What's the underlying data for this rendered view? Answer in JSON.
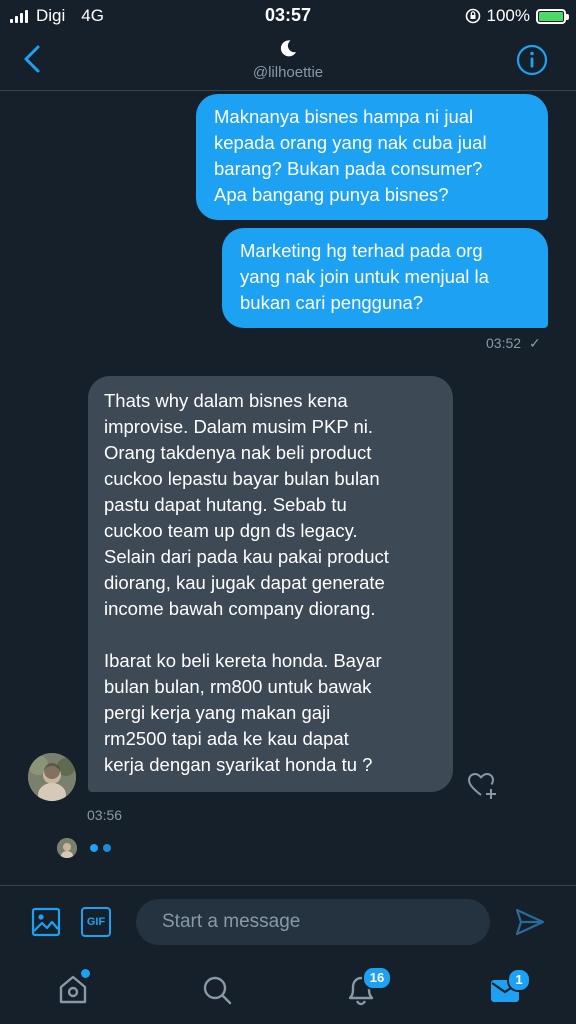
{
  "status_bar": {
    "carrier": "Digi",
    "network": "4G",
    "time": "03:57",
    "battery": "100%"
  },
  "header": {
    "handle": "@lilhoettie"
  },
  "conversation": {
    "sent_1": [
      "Maknanya bisnes hampa ni jual",
      "kepada orang yang nak cuba jual",
      "barang? Bukan pada consumer?",
      "Apa bangang punya bisnes?"
    ],
    "sent_2": [
      "Marketing hg terhad pada org",
      "yang nak join untuk menjual la",
      "bukan cari pengguna?"
    ],
    "sent_time": "03:52",
    "sent_status": "✓",
    "received_p1": [
      "Thats why dalam bisnes kena",
      "improvise. Dalam musim PKP ni.",
      "Orang takdenya nak beli product",
      "cuckoo lepastu bayar bulan bulan",
      "pastu dapat hutang. Sebab tu",
      "cuckoo team up dgn ds legacy.",
      "Selain dari pada kau pakai product",
      "diorang, kau jugak dapat generate",
      "income bawah company diorang."
    ],
    "received_p2": [
      "Ibarat ko beli kereta honda. Bayar",
      "bulan bulan, rm800 untuk bawak",
      "pergi kerja yang makan gaji",
      "rm2500 tapi ada ke kau dapat",
      "kerja dengan syarikat honda tu ?"
    ],
    "received_time": "03:56"
  },
  "composer": {
    "placeholder": "Start a message",
    "gif_label": "GIF"
  },
  "tabbar": {
    "notifications_badge": "16",
    "messages_badge": "1"
  },
  "colors": {
    "background": "#15202b",
    "accent": "#1da1f2",
    "received_bubble": "#3d4a56",
    "muted": "#8899a6"
  }
}
